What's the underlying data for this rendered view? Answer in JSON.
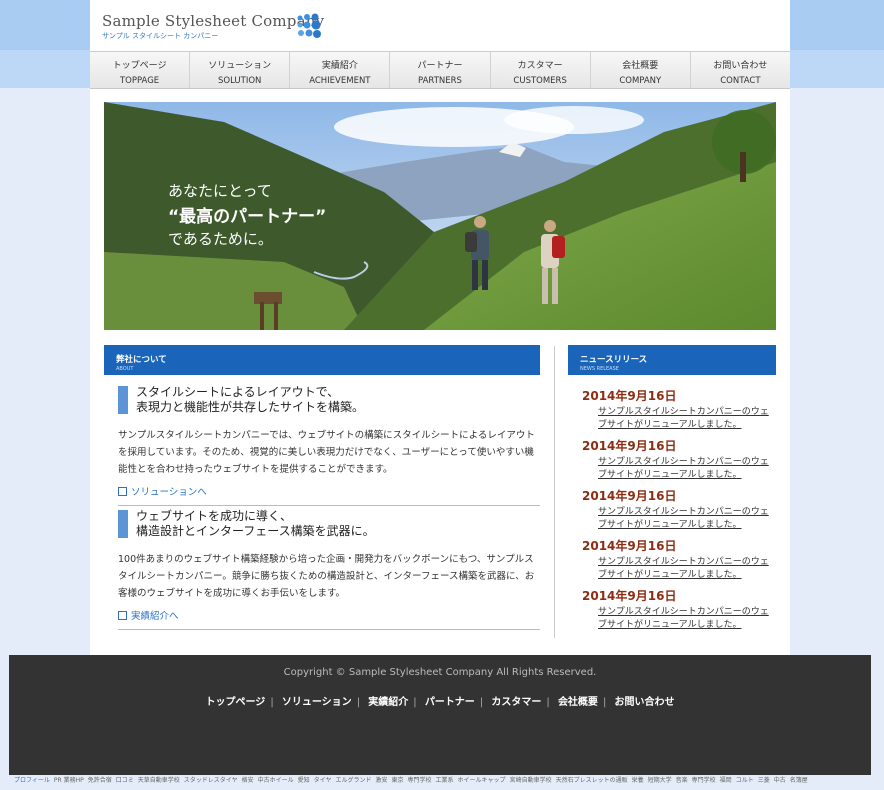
{
  "logo": {
    "name": "Sample Stylesheet Company",
    "sub": "サンプル スタイルシート カンパニー"
  },
  "nav": [
    {
      "jp": "トップページ",
      "en": "TOPPAGE"
    },
    {
      "jp": "ソリューション",
      "en": "SOLUTION"
    },
    {
      "jp": "実績紹介",
      "en": "ACHIEVEMENT"
    },
    {
      "jp": "パートナー",
      "en": "PARTNERS"
    },
    {
      "jp": "カスタマー",
      "en": "CUSTOMERS"
    },
    {
      "jp": "会社概要",
      "en": "COMPANY"
    },
    {
      "jp": "お問い合わせ",
      "en": "CONTACT"
    }
  ],
  "hero": {
    "line1": "あなたにとって",
    "line2": "“最高のパートナー”",
    "line3": "であるために。"
  },
  "about": {
    "title": "弊社について",
    "subtitle": "ABOUT",
    "features": [
      {
        "title1": "スタイルシートによるレイアウトで、",
        "title2": "表現力と機能性が共存したサイトを構築。",
        "body": "サンプルスタイルシートカンパニーでは、ウェブサイトの構築にスタイルシートによるレイアウトを採用しています。そのため、視覚的に美しい表現力だけでなく、ユーザーにとって使いやすい機能性とを合わせ持ったウェブサイトを提供することができます。",
        "link": "ソリューションへ"
      },
      {
        "title1": "ウェブサイトを成功に導く、",
        "title2": "構造設計とインターフェース構築を武器に。",
        "body": "100件あまりのウェブサイト構築経験から培った企画・開発力をバックボーンにもつ、サンプルスタイルシートカンパニー。競争に勝ち抜くための構造設計と、インターフェース構築を武器に、お客様のウェブサイトを成功に導くお手伝いをします。",
        "link": "実績紹介へ"
      }
    ]
  },
  "news": {
    "title": "ニュースリリース",
    "subtitle": "NEWS RELEASE",
    "items": [
      {
        "date": "2014年9月16日",
        "text": "サンプルスタイルシートカンパニーのウェブサイトがリニューアルしました。"
      },
      {
        "date": "2014年9月16日",
        "text": "サンプルスタイルシートカンパニーのウェブサイトがリニューアルしました。"
      },
      {
        "date": "2014年9月16日",
        "text": "サンプルスタイルシートカンパニーのウェブサイトがリニューアルしました。"
      },
      {
        "date": "2014年9月16日",
        "text": "サンプルスタイルシートカンパニーのウェブサイトがリニューアルしました。"
      },
      {
        "date": "2014年9月16日",
        "text": "サンプルスタイルシートカンパニーのウェブサイトがリニューアルしました。"
      }
    ]
  },
  "footer": {
    "copyright": "Copyright © Sample Stylesheet Company All Rights Reserved.",
    "links": [
      "トップページ",
      "ソリューション",
      "実績紹介",
      "パートナー",
      "カスタマー",
      "会社概要",
      "お問い合わせ"
    ]
  },
  "bottom_links": [
    "プロフィール",
    "PR 業務HP",
    "免許合宿",
    "口コミ",
    "天草自動車学校",
    "スタッドレスタイヤ",
    "格安",
    "中古ホイール",
    "愛知",
    "タイヤ",
    "エルグランド",
    "激安",
    "東京",
    "専門学校",
    "工業系",
    "ホイールキャップ",
    "宮崎自動車学校",
    "天然石ブレスレットの通販",
    "栄養",
    "短期大学",
    "音楽",
    "専門学校",
    "福岡",
    "コルト",
    "三菱",
    "中古",
    "名簿屋"
  ],
  "colors": {
    "brand_blue": "#1a65ba",
    "news_date": "#8b2d12",
    "link": "#2a6fc9"
  }
}
